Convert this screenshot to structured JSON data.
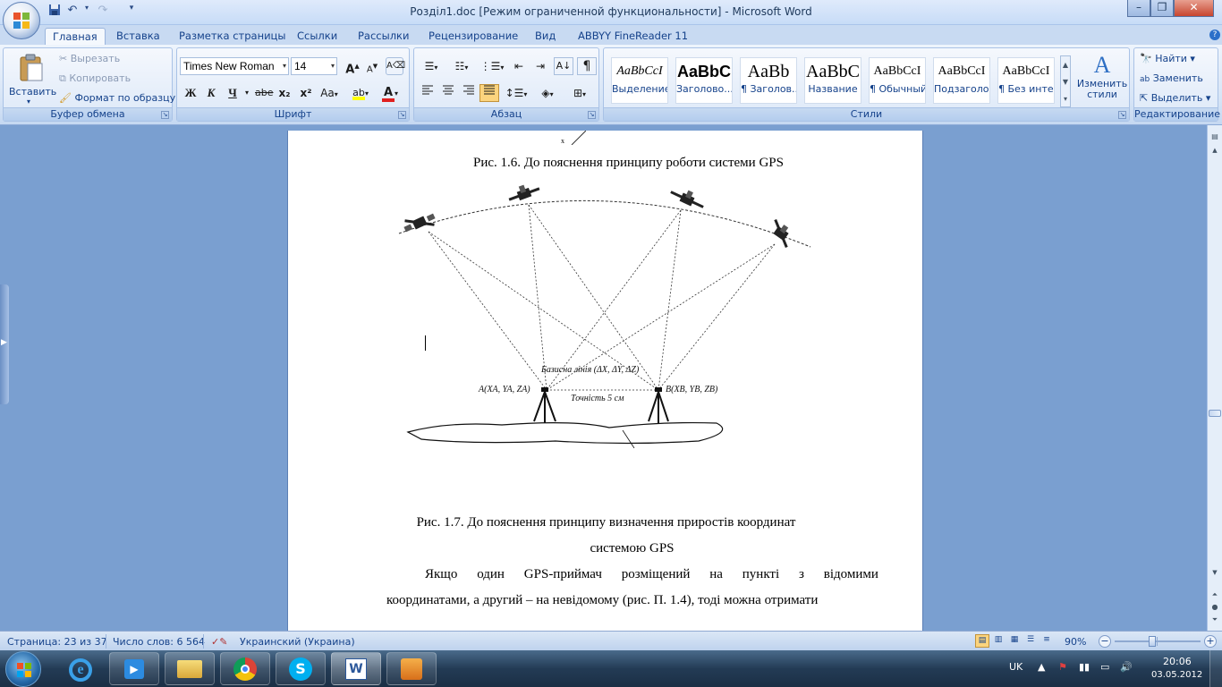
{
  "window": {
    "title": "Розділ1.doc [Режим ограниченной функциональности] - Microsoft Word",
    "minimize": "–",
    "restore": "❐",
    "close": "✕"
  },
  "tabs": [
    "Главная",
    "Вставка",
    "Разметка страницы",
    "Ссылки",
    "Рассылки",
    "Рецензирование",
    "Вид",
    "ABBYY FineReader 11"
  ],
  "clipboard": {
    "paste": "Вставить",
    "cut": "Вырезать",
    "copy": "Копировать",
    "format_painter": "Формат по образцу",
    "label": "Буфер обмена"
  },
  "font": {
    "name": "Times New Roman",
    "size": "14",
    "grow": "A",
    "shrink": "A",
    "bold": "Ж",
    "italic": "К",
    "underline": "Ч",
    "strike": "abe",
    "subscript": "x₂",
    "superscript": "x²",
    "change_case": "Aa",
    "color_letter": "A",
    "label": "Шрифт"
  },
  "paragraph": {
    "pilcrow": "¶",
    "label": "Абзац"
  },
  "styles": {
    "items": [
      {
        "sample": "AaBbCcI",
        "name": "Выделение"
      },
      {
        "sample": "AaBbC",
        "name": "Заголово..."
      },
      {
        "sample": "AaBb",
        "name": "¶ Заголов..."
      },
      {
        "sample": "AaBbC",
        "name": "Название"
      },
      {
        "sample": "AaBbCcI",
        "name": "¶ Обычный"
      },
      {
        "sample": "AaBbCcI",
        "name": "Подзаголо..."
      },
      {
        "sample": "AaBbCcI",
        "name": "¶ Без инте..."
      }
    ],
    "change_styles": "Изменить стили",
    "label": "Стили"
  },
  "editing": {
    "find": "Найти",
    "replace": "Заменить",
    "select": "Выделить",
    "label": "Редактирование"
  },
  "document": {
    "caption_1": "Рис. 1.6. До пояснення принципу роботи системи GPS",
    "figure": {
      "baseline": "Базисна лінія (ΔX, ΔY, ΔZ)",
      "point_a": "A(XA, YA, ZA)",
      "point_b": "B(XB, YB, ZB)",
      "accuracy": "Точність 5 см"
    },
    "caption_2_line1": "Рис. 1.7. До пояснення принципу визначення приростів координат",
    "caption_2_line2": "системою GPS",
    "para_line1_words": [
      "Якщо",
      "один",
      "GPS-приймач",
      "розміщений",
      "на",
      "пункті",
      "з",
      "відомими"
    ],
    "para_line2": "координатами, а другий – на невідомому (рис. П. 1.4), тоді можна отримати"
  },
  "statusbar": {
    "page": "Страница: 23 из 37",
    "words": "Число слов: 6 564",
    "language": "Украинский (Украина)",
    "zoom": "90%",
    "zoom_level": 0.9
  },
  "taskbar": {
    "lang": "UK",
    "time": "20:06",
    "date": "03.05.2012"
  },
  "colors": {
    "ribbon_text": "#15428b",
    "page": "#ffffff",
    "doc_background": "#7a9fd0"
  }
}
